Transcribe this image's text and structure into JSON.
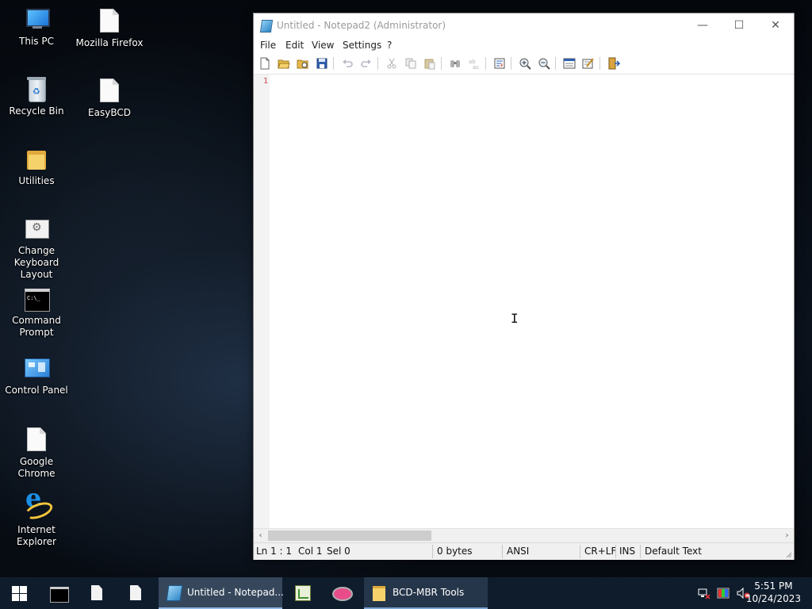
{
  "desktop": {
    "icons": [
      {
        "label": "This PC",
        "icon": "computer-icon"
      },
      {
        "label": "Mozilla Firefox",
        "icon": "document-icon"
      },
      {
        "label": "Recycle Bin",
        "icon": "recycle-bin-icon"
      },
      {
        "label": "EasyBCD",
        "icon": "document-icon"
      },
      {
        "label": "Utilities",
        "icon": "folder-icon"
      },
      {
        "label": "Change Keyboard Layout",
        "icon": "keyboard-settings-icon"
      },
      {
        "label": "Command Prompt",
        "icon": "terminal-icon"
      },
      {
        "label": "Control Panel",
        "icon": "control-panel-icon"
      },
      {
        "label": "Google Chrome",
        "icon": "document-icon"
      },
      {
        "label": "Internet Explorer",
        "icon": "internet-explorer-icon"
      }
    ]
  },
  "window": {
    "title": "Untitled - Notepad2 (Administrator)",
    "controls": {
      "minimize": "—",
      "maximize": "☐",
      "close": "✕"
    },
    "menu": [
      "File",
      "Edit",
      "View",
      "Settings",
      "?"
    ],
    "toolbar": {
      "icons": [
        "new-file-icon",
        "open-file-icon",
        "browse-icon",
        "save-icon",
        "undo-icon",
        "redo-icon",
        "cut-icon",
        "copy-icon",
        "paste-icon",
        "find-icon",
        "replace-icon",
        "word-wrap-icon",
        "zoom-in-icon",
        "zoom-out-icon",
        "scheme-icon",
        "customize-icon",
        "exit-icon"
      ]
    },
    "editor": {
      "line_number": "1",
      "content": ""
    },
    "scrollbar": {
      "left_arrow": "‹",
      "right_arrow": "›"
    },
    "status": {
      "position": "Ln 1 : 1",
      "column": "Col 1",
      "selection": "Sel 0",
      "size": "0 bytes",
      "encoding": "ANSI",
      "line_endings": "CR+LF",
      "insert_mode": "INS",
      "scheme": "Default Text"
    }
  },
  "taskbar": {
    "apps": [
      {
        "icon": "terminal-icon"
      },
      {
        "icon": "document-icon"
      },
      {
        "icon": "document-icon"
      },
      {
        "icon": "notepad-icon",
        "label": "Untitled - Notepad..."
      },
      {
        "icon": "chart-icon"
      },
      {
        "icon": "paint-icon"
      },
      {
        "icon": "folder-icon",
        "label": "BCD-MBR Tools"
      }
    ],
    "tray_icons": [
      "network-icon",
      "color-icon",
      "volume-muted-icon"
    ],
    "clock": {
      "time": "5:51 PM",
      "date": "10/24/2023"
    }
  },
  "colors": {
    "accent": "#8fb6e3",
    "taskbar": "#0f1c2c",
    "line_number": "#cc4444"
  }
}
